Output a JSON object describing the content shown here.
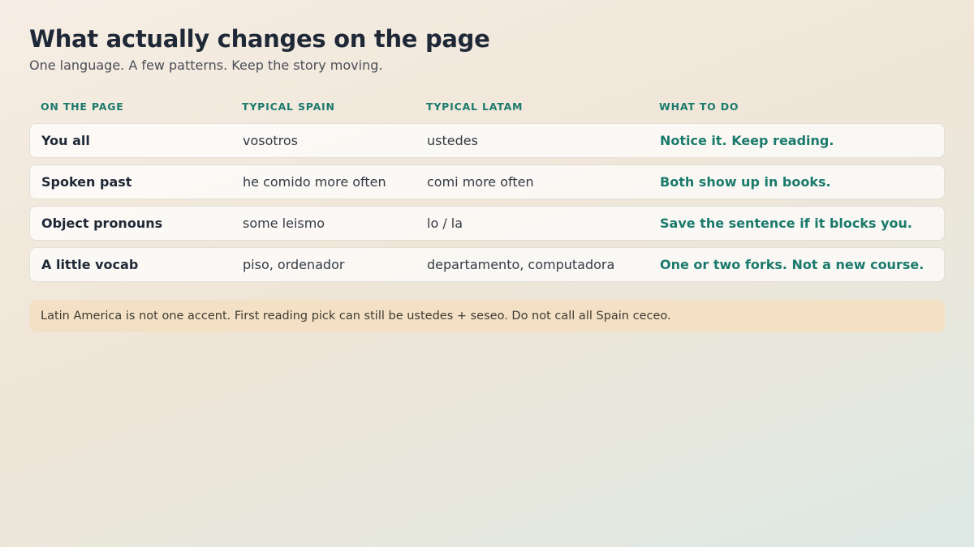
{
  "page": {
    "title": "What actually changes on the page",
    "subtitle": "One language. A few patterns. Keep the story moving."
  },
  "table": {
    "headers": [
      "ON THE PAGE",
      "TYPICAL SPAIN",
      "TYPICAL LATAM",
      "WHAT TO DO"
    ],
    "rows": [
      {
        "label": "You all",
        "spain": "vosotros",
        "latam": "ustedes",
        "action": "Notice it. Keep reading."
      },
      {
        "label": "Spoken past",
        "spain": "he comido more often",
        "latam": "comi more often",
        "action": "Both show up in books."
      },
      {
        "label": "Object pronouns",
        "spain": "some leismo",
        "latam": "lo / la",
        "action": "Save the sentence if it blocks you."
      },
      {
        "label": "A little vocab",
        "spain": "piso, ordenador",
        "latam": "departamento, computadora",
        "action": "One or two forks. Not a new course."
      }
    ]
  },
  "note": {
    "text": "Latin America is not one accent. First reading pick can still be ustedes + seseo. Do not call all Spain ceceo."
  },
  "colors": {
    "accent": "#1b7a6c",
    "note_background": "#f4e1c5"
  }
}
